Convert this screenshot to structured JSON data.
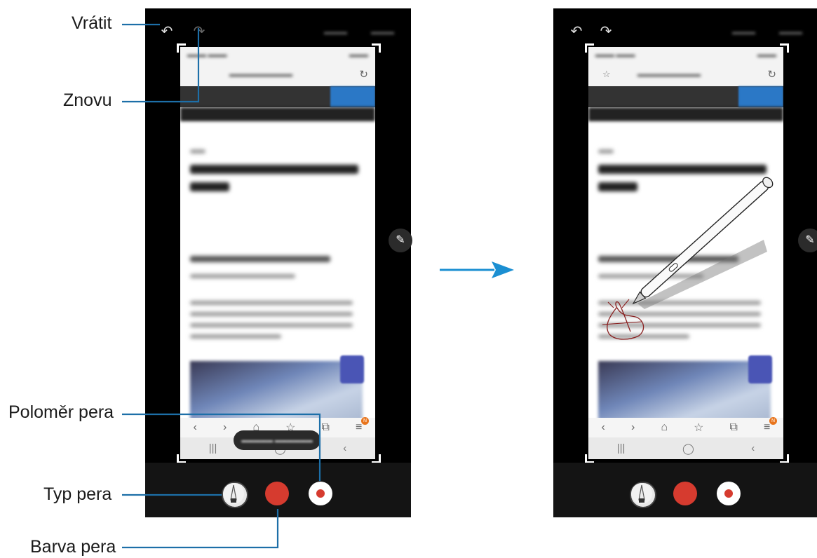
{
  "callouts": {
    "undo": "Vrátit",
    "redo": "Znovu",
    "pen_size": "Poloměr pera",
    "pen_type": "Typ pera",
    "pen_color": "Barva pera"
  },
  "colors": {
    "pen_color": "#d63b2f",
    "callout_line": "#1d6fa8",
    "arrow": "#1b8fd2",
    "phone_bg": "#000000"
  },
  "icons": {
    "undo": "undo-icon",
    "redo": "redo-icon",
    "edit_handle": "pencil-icon",
    "pen_type": "pen-tip-icon"
  },
  "notification_badge": "N"
}
